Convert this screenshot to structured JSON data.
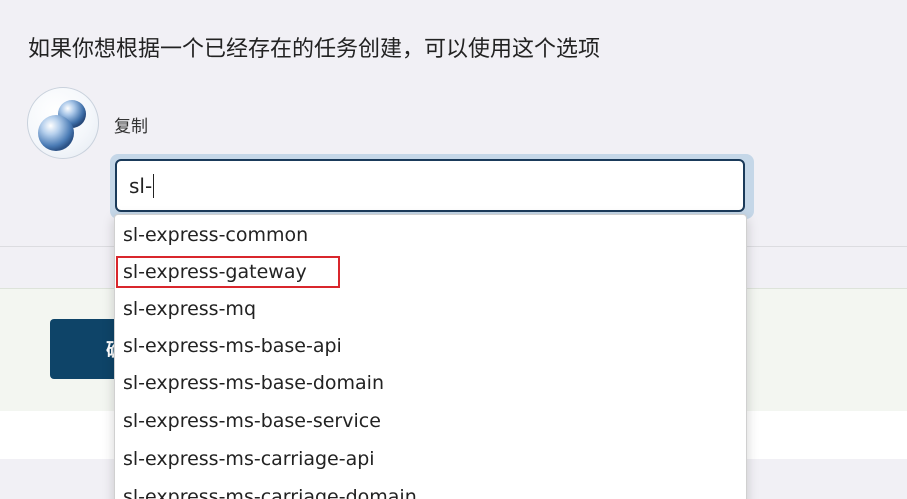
{
  "heading": "如果你想根据一个已经存在的任务创建，可以使用这个选项",
  "copy_option": {
    "label": "复制",
    "icon": "copy-spheres-icon"
  },
  "search": {
    "value": "sl-"
  },
  "ok_button": {
    "label": "确"
  },
  "dropdown": {
    "items": [
      "sl-express-common",
      "sl-express-gateway",
      "sl-express-mq",
      "sl-express-ms-base-api",
      "sl-express-ms-base-domain",
      "sl-express-ms-base-service",
      "sl-express-ms-carriage-api",
      "sl-express-ms-carriage-domain"
    ],
    "highlighted": "sl-express-gateway"
  },
  "colors": {
    "button_bg": "#0e4468",
    "input_border": "#1a3a5a",
    "highlight_border": "#d9262c"
  }
}
